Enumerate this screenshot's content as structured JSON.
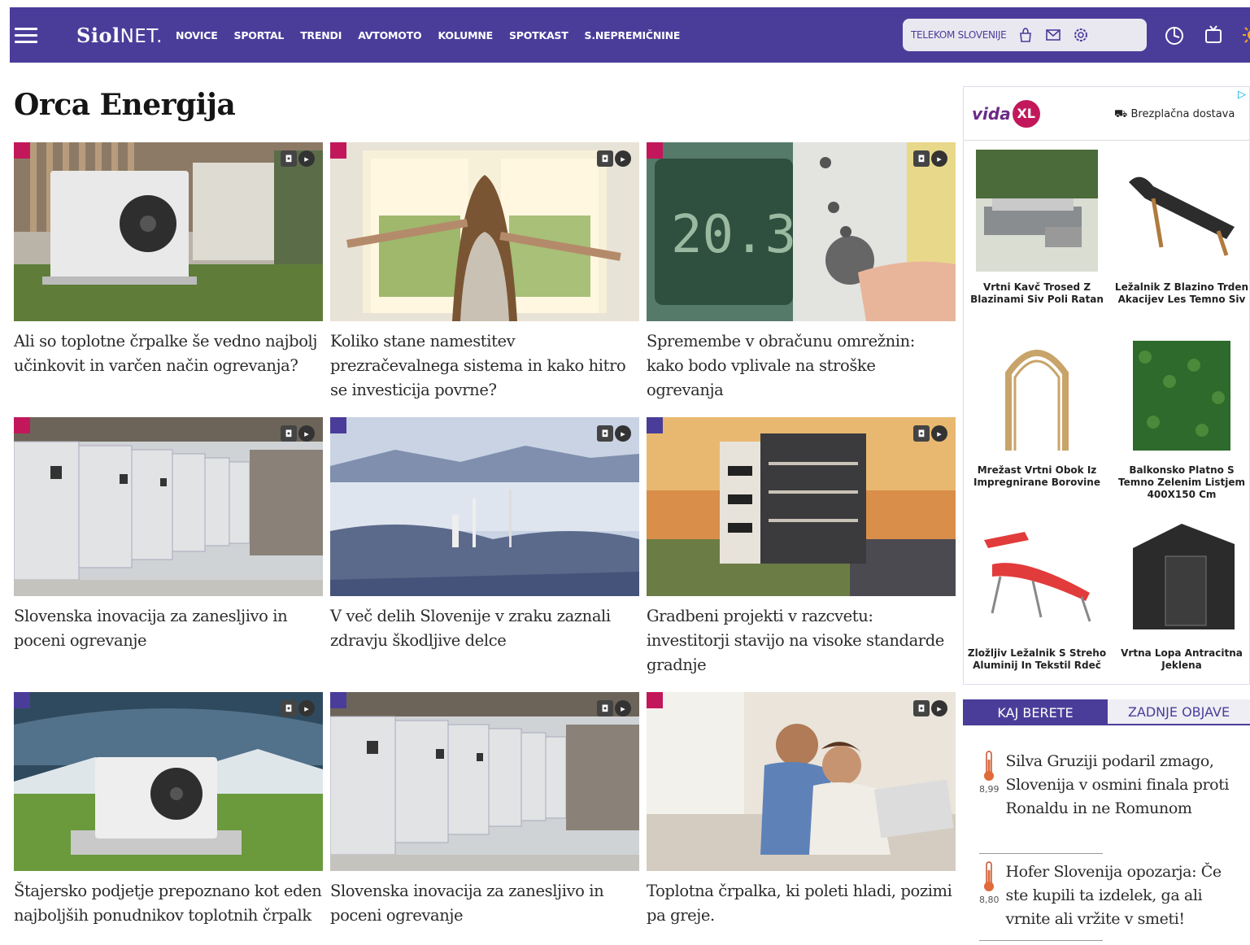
{
  "nav": {
    "logo_bold": "Siol",
    "logo_light": "NET.",
    "items": [
      "NOVICE",
      "SPORTAL",
      "TRENDI",
      "AVTOMOTO",
      "KOLUMNE",
      "SPOTKAST",
      "S.NEPREMIČNINE"
    ],
    "telekom_label": "TELEKOM SLOVENIJE",
    "icons": [
      "shop-icon",
      "mail-icon",
      "settings-icon",
      "music-icon",
      "tv-icon",
      "sun-icon"
    ]
  },
  "page": {
    "title": "Orca Energija"
  },
  "articles": [
    {
      "headline": "Ali so toplotne črpalke še vedno najbolj učinkovit in varčen način ogrevanja?",
      "tag_color": "#c2185b"
    },
    {
      "headline": "Koliko stane namestitev prezračevalnega sistema in kako hitro se investicija povrne?",
      "tag_color": "#c2185b"
    },
    {
      "headline": "Spremembe v obračunu omrežnin: kako bodo vplivale na stroške ogrevanja",
      "tag_color": "#c2185b"
    },
    {
      "headline": "Slovenska inovacija za zanesljivo in poceni ogrevanje",
      "tag_color": "#c2185b"
    },
    {
      "headline": "V več delih Slovenije v zraku zaznali zdravju škodljive delce",
      "tag_color": "#4a3d9a"
    },
    {
      "headline": "Gradbeni projekti v razcvetu: investitorji stavijo na visoke standarde gradnje",
      "tag_color": "#4a3d9a"
    },
    {
      "headline": "Štajersko podjetje prepoznano kot eden najboljših ponudnikov toplotnih črpalk",
      "tag_color": "#4a3d9a"
    },
    {
      "headline": "Slovenska inovacija za zanesljivo in poceni ogrevanje",
      "tag_color": "#4a3d9a"
    },
    {
      "headline": "Toplotna črpalka, ki poleti hladi, pozimi pa greje.",
      "tag_color": "#c2185b"
    }
  ],
  "ad": {
    "brand": "vida",
    "brand_xl": "XL",
    "shipping": "Brezplačna dostava",
    "products": [
      {
        "name": "Vrtni Kavč Trosed Z Blazinami Siv Poli Ratan"
      },
      {
        "name": "Ležalnik Z Blazino Trden Akacijev Les Temno Siv"
      },
      {
        "name": "Mrežast Vrtni Obok Iz Impregnirane Borovine"
      },
      {
        "name": "Balkonsko Platno S Temno Zelenim Listjem 400X150 Cm"
      },
      {
        "name": "Zložljiv Ležalnik S Streho Aluminij In Tekstil Rdeč"
      },
      {
        "name": "Vrtna Lopa Antracitna Jeklena"
      }
    ]
  },
  "sidebar": {
    "tab_active": "KAJ BERETE",
    "tab_inactive": "ZADNJE OBJAVE",
    "trending": [
      {
        "score": "8,99",
        "text": "Silva Gruziji podaril zmago, Slovenija v osmini finala proti Ronaldu in ne Romunom"
      },
      {
        "score": "8,80",
        "text": "Hofer Slovenija opozarja: Če ste kupili ta izdelek, ga ali vrnite ali vržite v smeti!"
      }
    ]
  },
  "colors": {
    "brand": "#4a3d9a",
    "accent_pink": "#c2185b"
  }
}
